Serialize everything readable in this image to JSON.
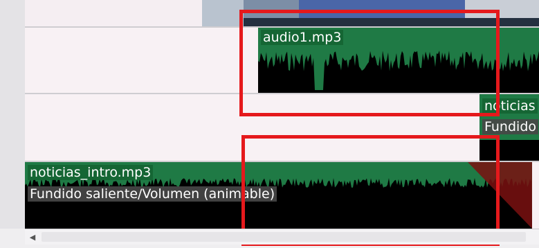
{
  "tracks": {
    "audio1": {
      "name": "audio1.mp3"
    },
    "noticias": {
      "name": "noticias",
      "effect": "Fundido"
    },
    "noticias_intro": {
      "name": "noticias_intro.mp3",
      "effect": "Fundido saliente/Volumen (animable)"
    }
  },
  "scrollbar": {
    "left_arrow": "◀"
  },
  "colors": {
    "clip_green": "#1f7a45",
    "waveform": "#000000",
    "fade_out": "#7a1010",
    "annotation": "#e5191c"
  }
}
